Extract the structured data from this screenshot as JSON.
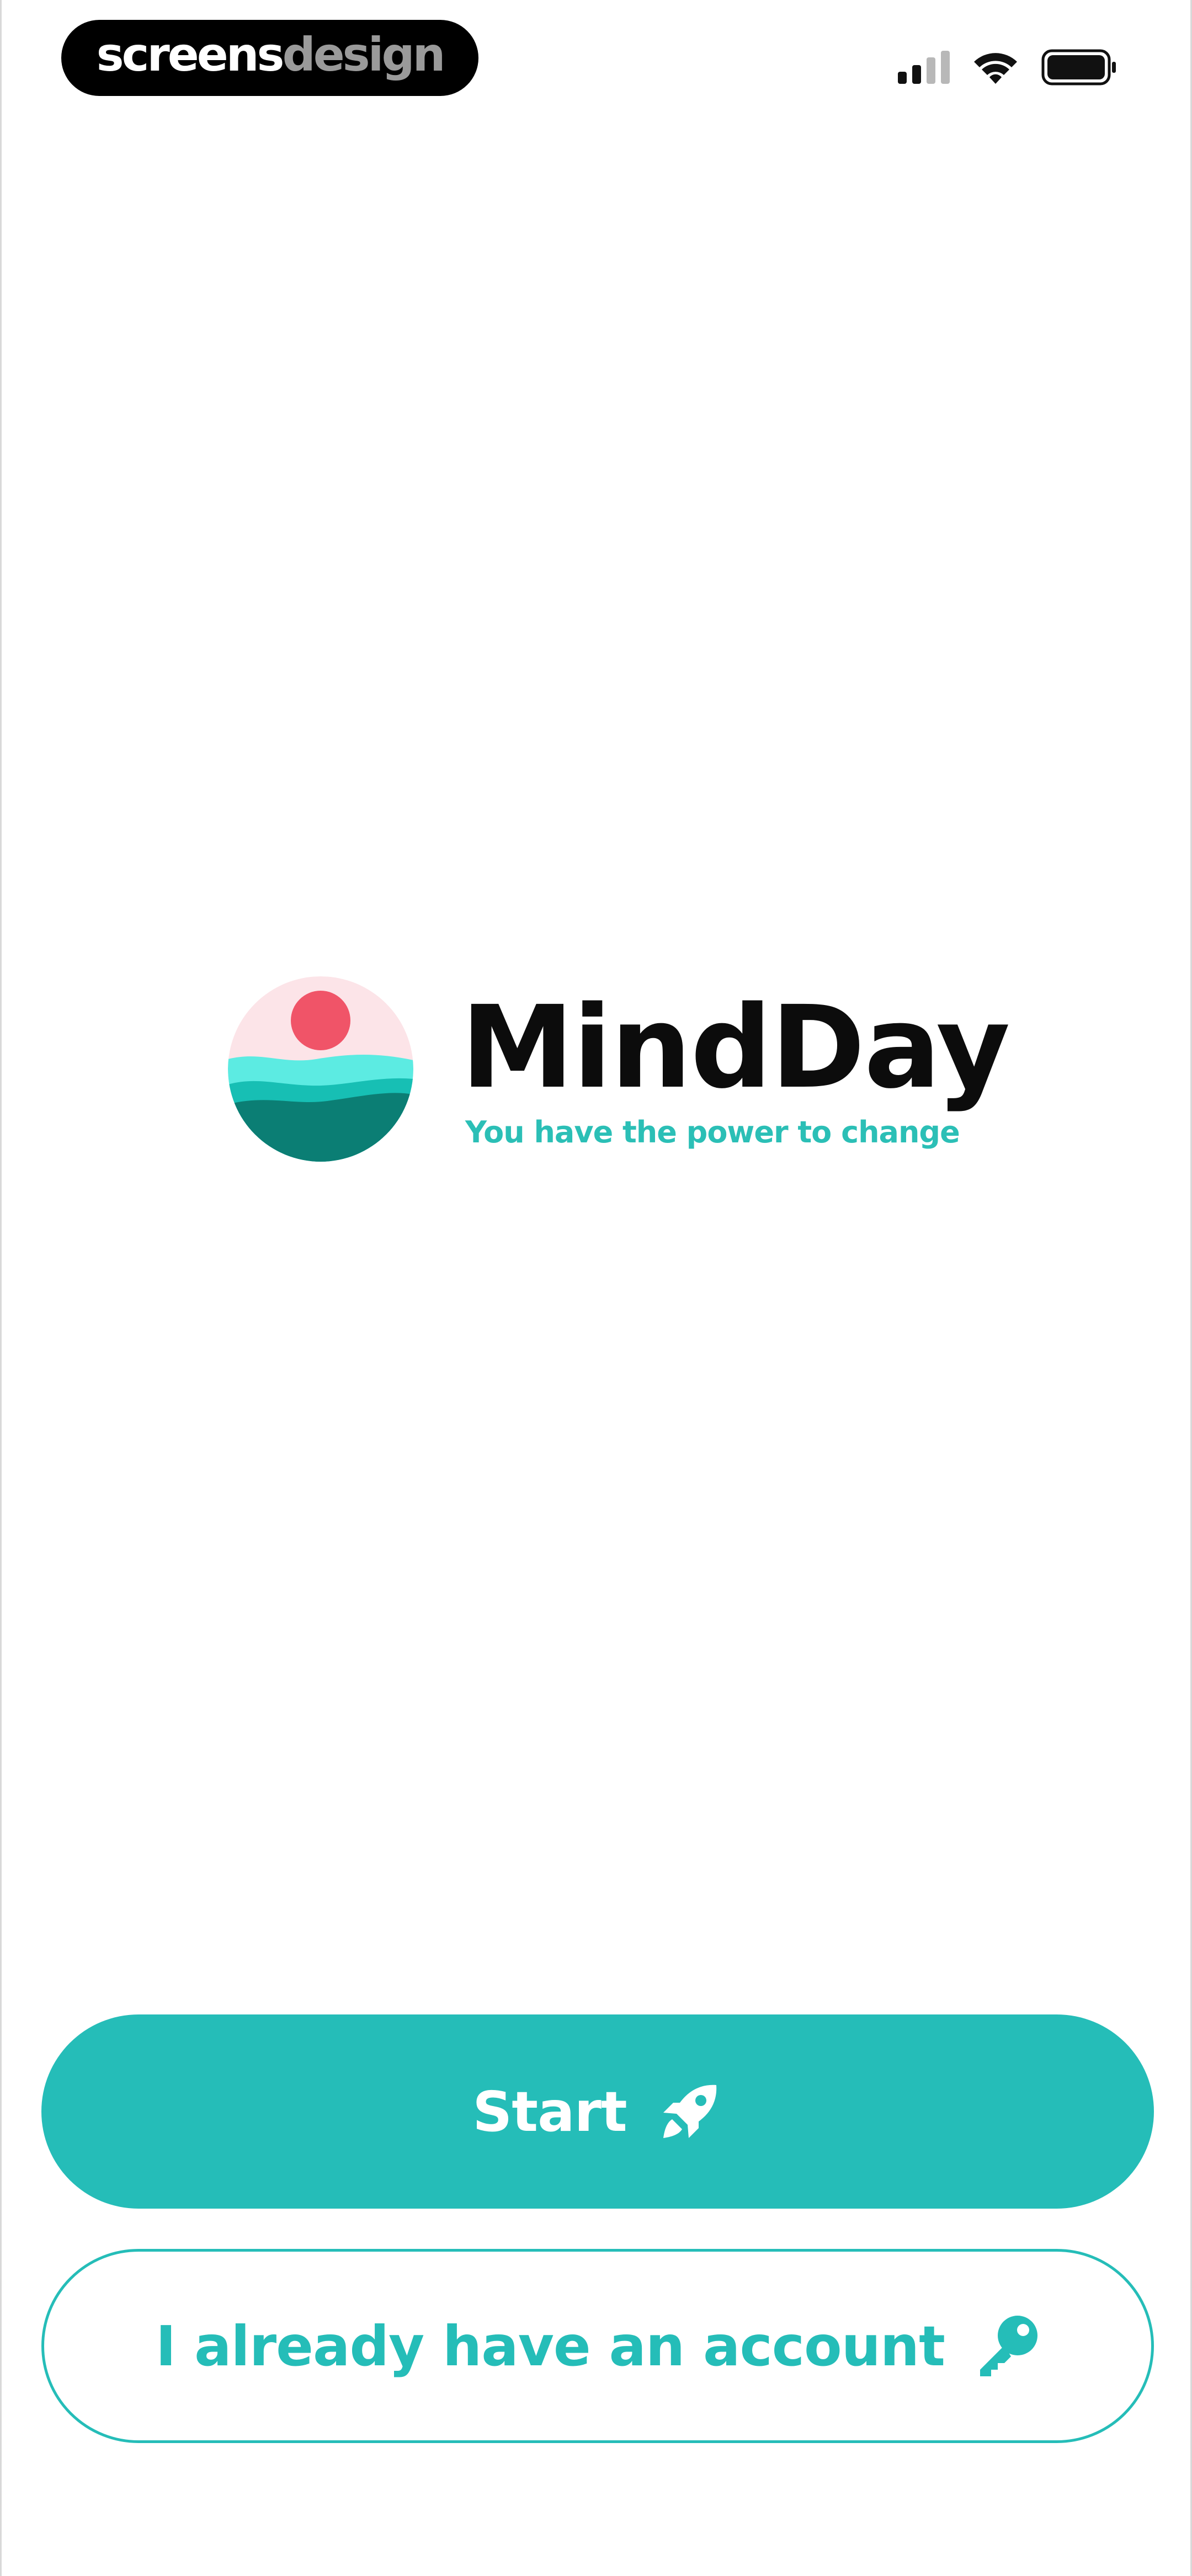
{
  "status_bar": {
    "watermark_part1": "screens",
    "watermark_part2": "design",
    "icons": [
      "cellular-signal-icon",
      "wifi-icon",
      "battery-icon"
    ]
  },
  "brand": {
    "name": "MindDay",
    "tagline": "You have the power to change",
    "logo": "sunset-waves-logo"
  },
  "actions": {
    "start_label": "Start",
    "start_icon": "rocket-icon",
    "login_label": "I already have an account",
    "login_icon": "key-icon"
  },
  "colors": {
    "accent": "#25BDB8",
    "sun": "#F05468",
    "sky": "#FCE4E8",
    "wave_light": "#5CEBE2",
    "wave_mid": "#17BFB4",
    "wave_dark": "#0B7E74",
    "text_dark": "#0C0C0C"
  }
}
